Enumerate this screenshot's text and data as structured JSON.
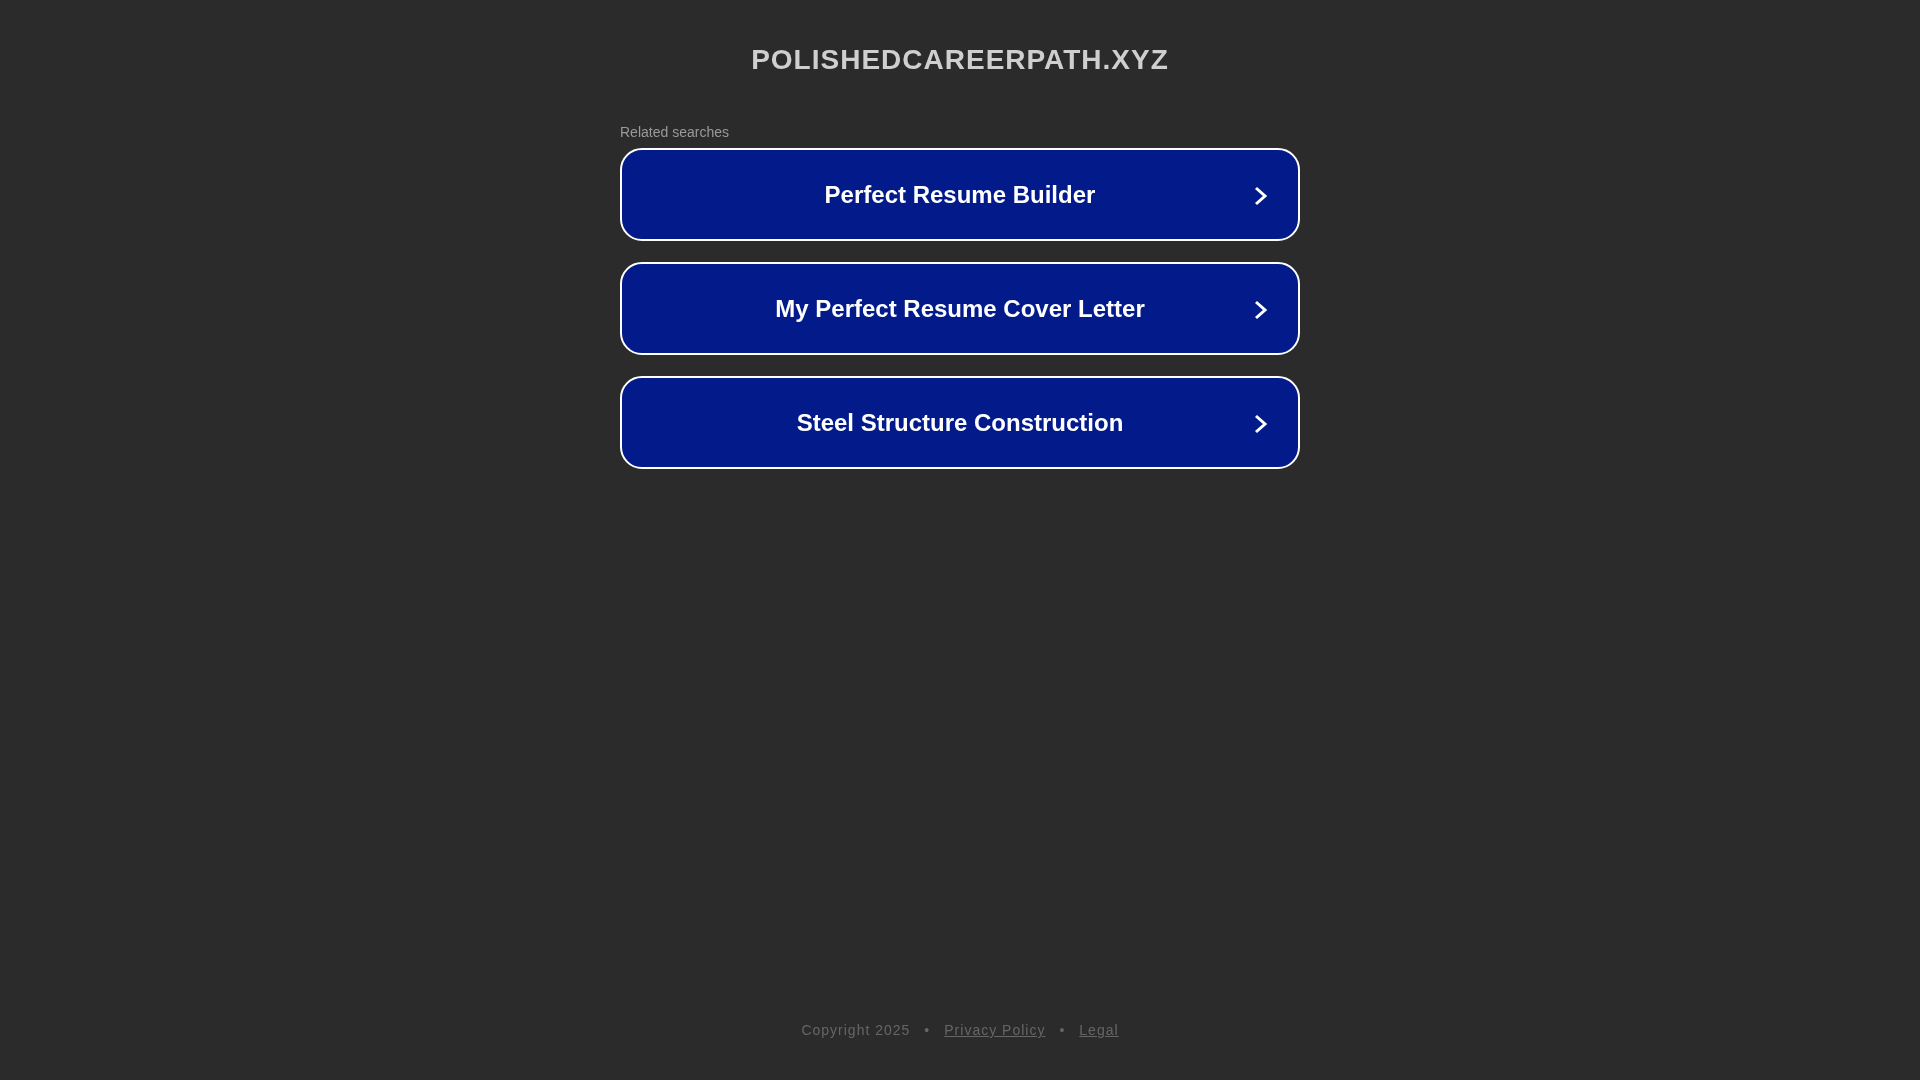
{
  "site_title": "POLISHEDCAREERPATH.XYZ",
  "related_label": "Related searches",
  "searches": [
    {
      "label": "Perfect Resume Builder"
    },
    {
      "label": "My Perfect Resume Cover Letter"
    },
    {
      "label": "Steel Structure Construction"
    }
  ],
  "footer": [
    {
      "kind": "text",
      "text": "Copyright 2025"
    },
    {
      "kind": "separator",
      "text": "•"
    },
    {
      "kind": "link",
      "text": "Privacy Policy"
    },
    {
      "kind": "separator",
      "text": "•"
    },
    {
      "kind": "link",
      "text": "Legal"
    }
  ]
}
